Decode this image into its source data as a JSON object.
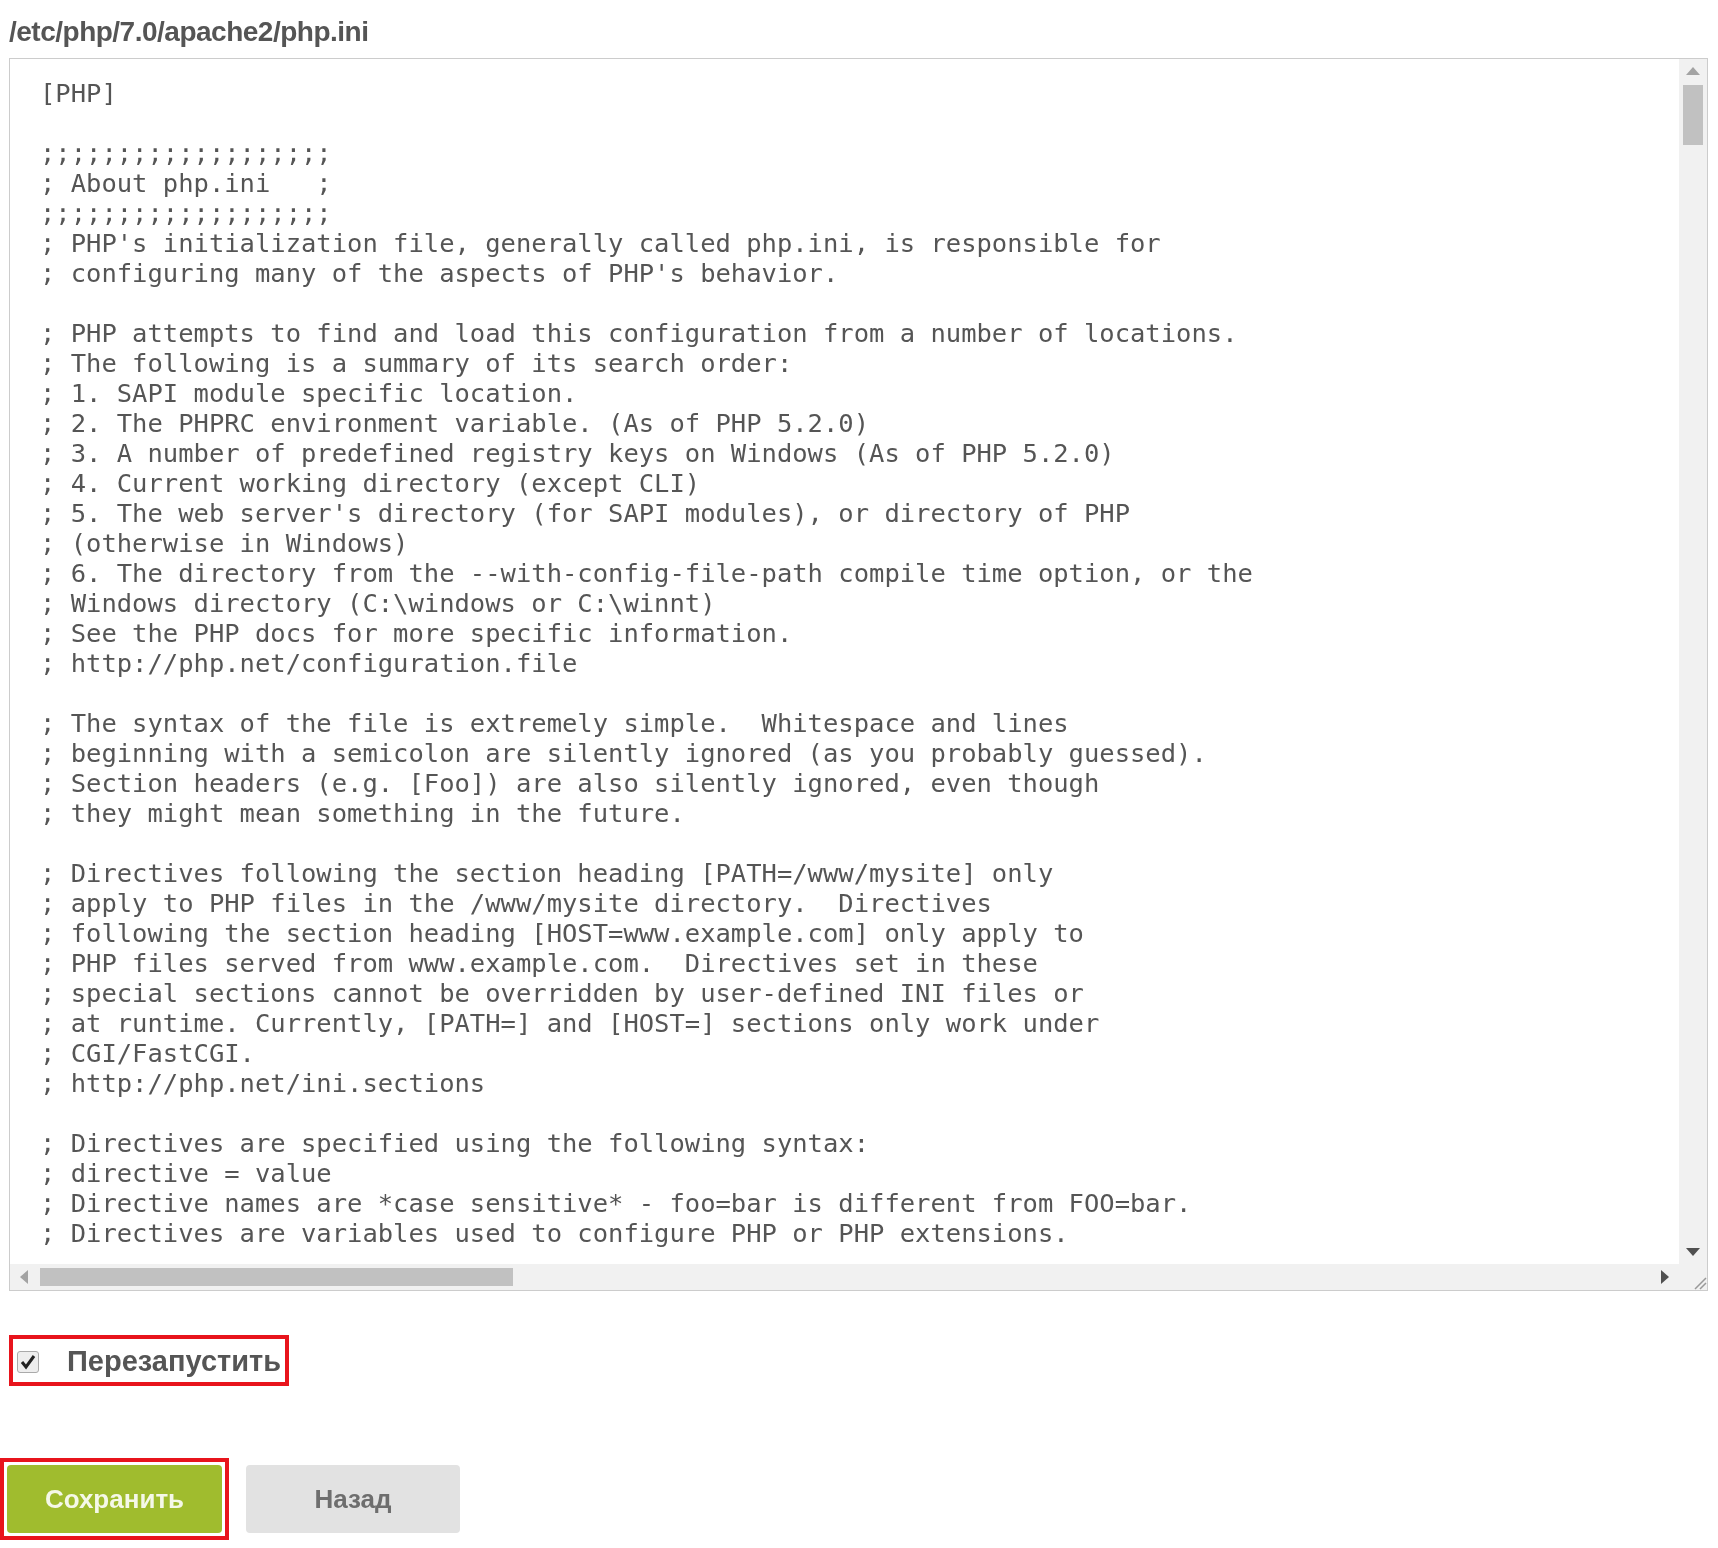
{
  "file_path": "/etc/php/7.0/apache2/php.ini",
  "editor": {
    "blocks": [
      [
        "[PHP]"
      ],
      [
        ";;;;;;;;;;;;;;;;;;;",
        "; About php.ini   ;",
        ";;;;;;;;;;;;;;;;;;;",
        "; PHP's initialization file, generally called php.ini, is responsible for",
        "; configuring many of the aspects of PHP's behavior."
      ],
      [
        "; PHP attempts to find and load this configuration from a number of locations.",
        "; The following is a summary of its search order:",
        "; 1. SAPI module specific location.",
        "; 2. The PHPRC environment variable. (As of PHP 5.2.0)",
        "; 3. A number of predefined registry keys on Windows (As of PHP 5.2.0)",
        "; 4. Current working directory (except CLI)",
        "; 5. The web server's directory (for SAPI modules), or directory of PHP",
        "; (otherwise in Windows)",
        "; 6. The directory from the --with-config-file-path compile time option, or the",
        "; Windows directory (C:\\windows or C:\\winnt)",
        "; See the PHP docs for more specific information.",
        "; http://php.net/configuration.file"
      ],
      [
        "; The syntax of the file is extremely simple.  Whitespace and lines",
        "; beginning with a semicolon are silently ignored (as you probably guessed).",
        "; Section headers (e.g. [Foo]) are also silently ignored, even though",
        "; they might mean something in the future."
      ],
      [
        "; Directives following the section heading [PATH=/www/mysite] only",
        "; apply to PHP files in the /www/mysite directory.  Directives",
        "; following the section heading [HOST=www.example.com] only apply to",
        "; PHP files served from www.example.com.  Directives set in these",
        "; special sections cannot be overridden by user-defined INI files or",
        "; at runtime. Currently, [PATH=] and [HOST=] sections only work under",
        "; CGI/FastCGI.",
        "; http://php.net/ini.sections"
      ],
      [
        "; Directives are specified using the following syntax:",
        "; directive = value",
        "; Directive names are *case sensitive* - foo=bar is different from FOO=bar.",
        "; Directives are variables used to configure PHP or PHP extensions."
      ]
    ]
  },
  "restart": {
    "label": "Перезапустить",
    "checked": true,
    "highlighted": true
  },
  "buttons": [
    {
      "label": "Сохранить",
      "kind": "primary",
      "highlighted": true
    },
    {
      "label": "Назад",
      "kind": "secondary",
      "highlighted": false
    }
  ]
}
